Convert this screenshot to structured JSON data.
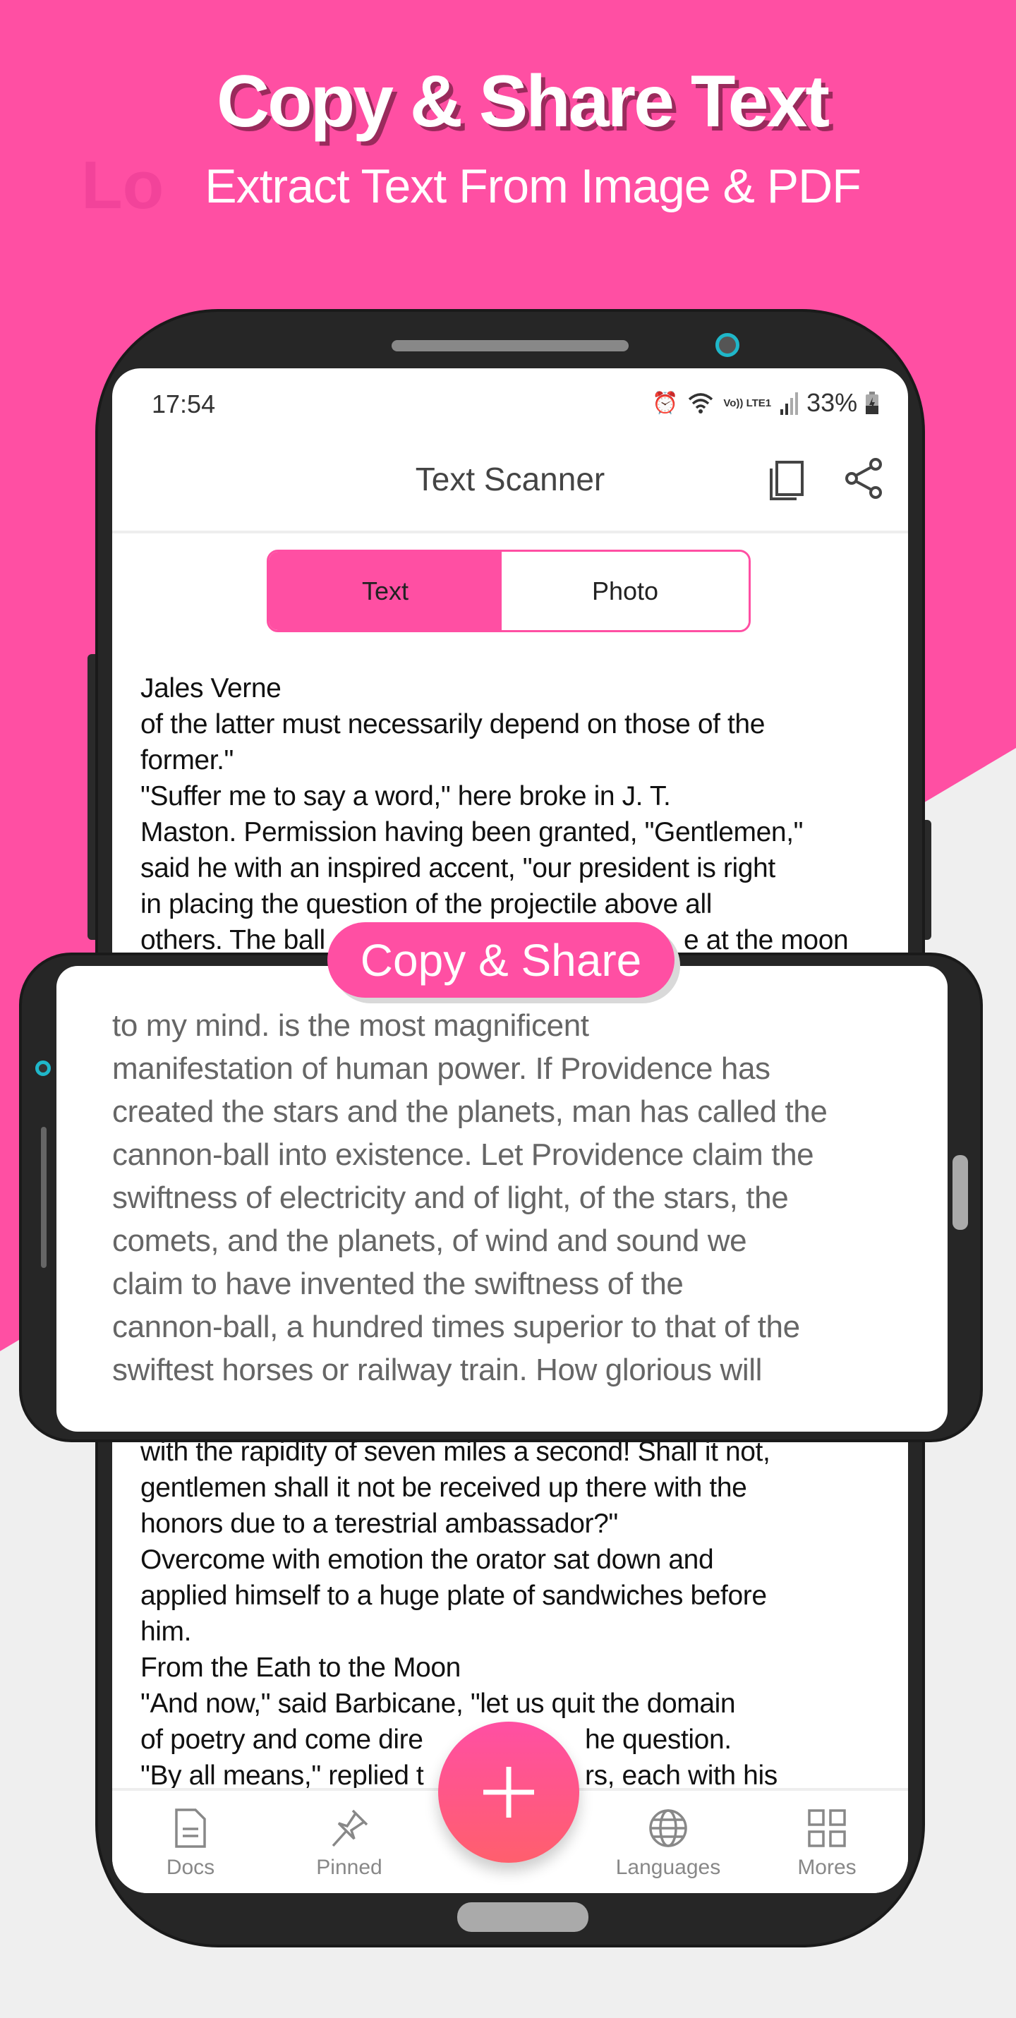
{
  "promo": {
    "headline": "Copy & Share Text",
    "subline": "Extract Text From Image & PDF",
    "ghost": "Lo",
    "badge": "Copy & Share"
  },
  "colors": {
    "brand_pink": "#ff4fa3",
    "fab_top": "#ff4fa3",
    "fab_bottom": "#ff5f6d"
  },
  "status": {
    "time": "17:54",
    "network": "Vo)) LTE1",
    "battery": "33%"
  },
  "toolbar": {
    "title": "Text Scanner",
    "copy_icon": "copy-icon",
    "share_icon": "share-icon"
  },
  "segments": {
    "text": "Text",
    "photo": "Photo",
    "selected": "Text"
  },
  "document_top": [
    "Jales Verne",
    "of the latter must necessarily depend on those of the",
    "former.\"",
    "\"Suffer me to say a word,\" here broke in J. T.",
    "Maston. Permission having been granted, \"Gentlemen,\"",
    "said he with an inspired accent, \"our president is right",
    "in placing the question of the projectile above all"
  ],
  "document_partial": {
    "left": "others. The ball",
    "right": "e at the moon"
  },
  "overlay_text": [
    "to my mind. is the most magnificent",
    "manifestation of human power. If Providence has",
    "created the stars and the planets, man has called the",
    "cannon-ball into existence. Let Providence claim the",
    "swiftness of electricity and of light, of the stars, the",
    "comets, and the planets, of wind and sound we",
    "claim to have invented the swiftness of the",
    "cannon-ball, a hundred times superior to that of the",
    "swiftest horses or railway train. How glorious will"
  ],
  "document_bottom": [
    "with the rapidity of seven miles a second! Shall it not,",
    "gentlemen shall it not be received up there with the",
    "honors due to a terestrial ambassador?\"",
    "Overcome with emotion the orator sat down and",
    "applied himself to a huge plate of sandwiches before",
    "him.",
    "From the Eath to the Moon",
    "\"And now,\" said Barbicane, \"let us quit the domain"
  ],
  "document_bottom_partial": [
    {
      "left": "of poetry and come dire",
      "right": "he question."
    },
    {
      "left": "\"By all means,\" replied t",
      "right": "rs, each with his"
    }
  ],
  "nav": {
    "docs": "Docs",
    "pinned": "Pinned",
    "languages": "Languages",
    "mores": "Mores",
    "fab_icon": "plus-icon"
  }
}
